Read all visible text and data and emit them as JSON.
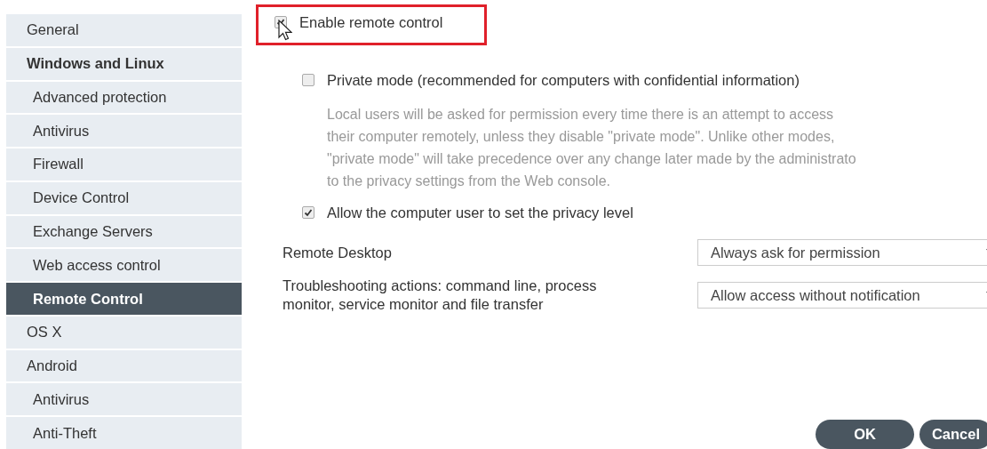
{
  "sidebar": {
    "items": [
      {
        "label": "General",
        "selected": false
      },
      {
        "label": "Windows and Linux",
        "selected": false,
        "children": [
          {
            "label": "Advanced protection",
            "selected": false
          },
          {
            "label": "Antivirus",
            "selected": false
          },
          {
            "label": "Firewall",
            "selected": false
          },
          {
            "label": "Device Control",
            "selected": false
          },
          {
            "label": "Exchange Servers",
            "selected": false
          },
          {
            "label": "Web access control",
            "selected": false
          },
          {
            "label": "Remote Control",
            "selected": true
          }
        ]
      },
      {
        "label": "OS X",
        "selected": false
      },
      {
        "label": "Android",
        "selected": false,
        "children": [
          {
            "label": "Antivirus",
            "selected": false
          },
          {
            "label": "Anti-Theft",
            "selected": false
          }
        ]
      }
    ]
  },
  "enable_option": {
    "label": "Enable remote control",
    "checked": true,
    "highlighted": true
  },
  "private_mode": {
    "label": "Private mode (recommended for computers with confidential information)",
    "checked": false,
    "description_lines": [
      "Local users will be asked for permission every time there is an attempt to access",
      "their computer remotely, unless they disable \"private mode\". Unlike other modes,",
      "\"private mode\" will take precedence over any change later made by the administrato",
      "to the privacy settings from the Web console."
    ]
  },
  "allow_option": {
    "label": "Allow the computer user to set the privacy level",
    "checked": true
  },
  "settings": [
    {
      "label": "Remote Desktop",
      "value": "Always ask for permission"
    },
    {
      "label": "Troubleshooting actions: command line, process monitor, service monitor and file transfer",
      "value": "Allow access without notification"
    }
  ],
  "buttons": [
    {
      "label": "OK"
    },
    {
      "label": "Cancel"
    }
  ]
}
